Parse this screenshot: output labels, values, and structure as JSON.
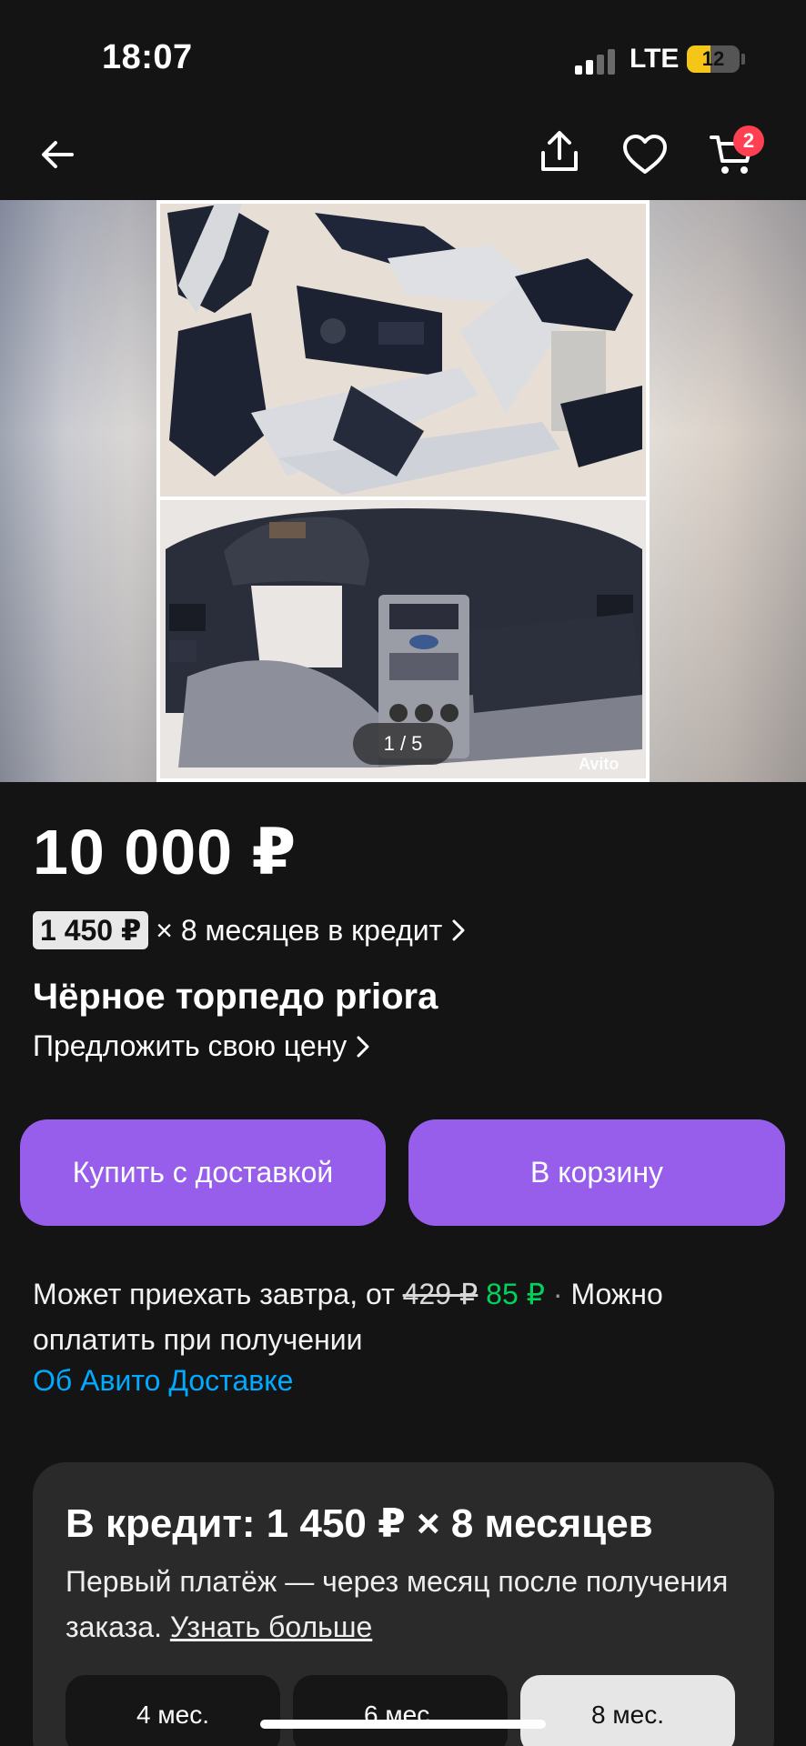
{
  "status": {
    "time": "18:07",
    "network": "LTE",
    "battery": "12",
    "battery_level": 0.12
  },
  "nav": {
    "back_icon": "arrow-left-icon",
    "share_icon": "share-icon",
    "favorite_icon": "heart-icon",
    "cart_icon": "cart-icon",
    "cart_badge": "2"
  },
  "gallery": {
    "counter": "1 / 5",
    "watermark": "Avito"
  },
  "listing": {
    "price": "10 000 ₽",
    "credit_amount": "1 450 ₽",
    "credit_text": "× 8 месяцев в кредит",
    "title": "Чёрное торпедо priora",
    "offer_price": "Предложить свою цену"
  },
  "buttons": {
    "buy_delivery": "Купить с доставкой",
    "add_to_cart": "В корзину"
  },
  "delivery": {
    "text_before": "Может приехать завтра, от ",
    "old_price": "429 ₽",
    "new_price": "85 ₽",
    "separator": " · ",
    "text_after": "Можно оплатить при получении",
    "link": "Об Авито Доставке"
  },
  "credit_card": {
    "title": "В кредит: 1 450 ₽ × 8 месяцев",
    "text": "Первый платёж — через месяц после получения заказа. ",
    "more_link": "Узнать больше",
    "months": [
      "4 мес.",
      "6 мес.",
      "8 мес."
    ],
    "selected": "8 мес."
  },
  "colors": {
    "background": "#141414",
    "accent_purple": "#965eeb",
    "link_blue": "#00aaff",
    "price_green": "#02d15c",
    "badge_red": "#ff4053"
  }
}
